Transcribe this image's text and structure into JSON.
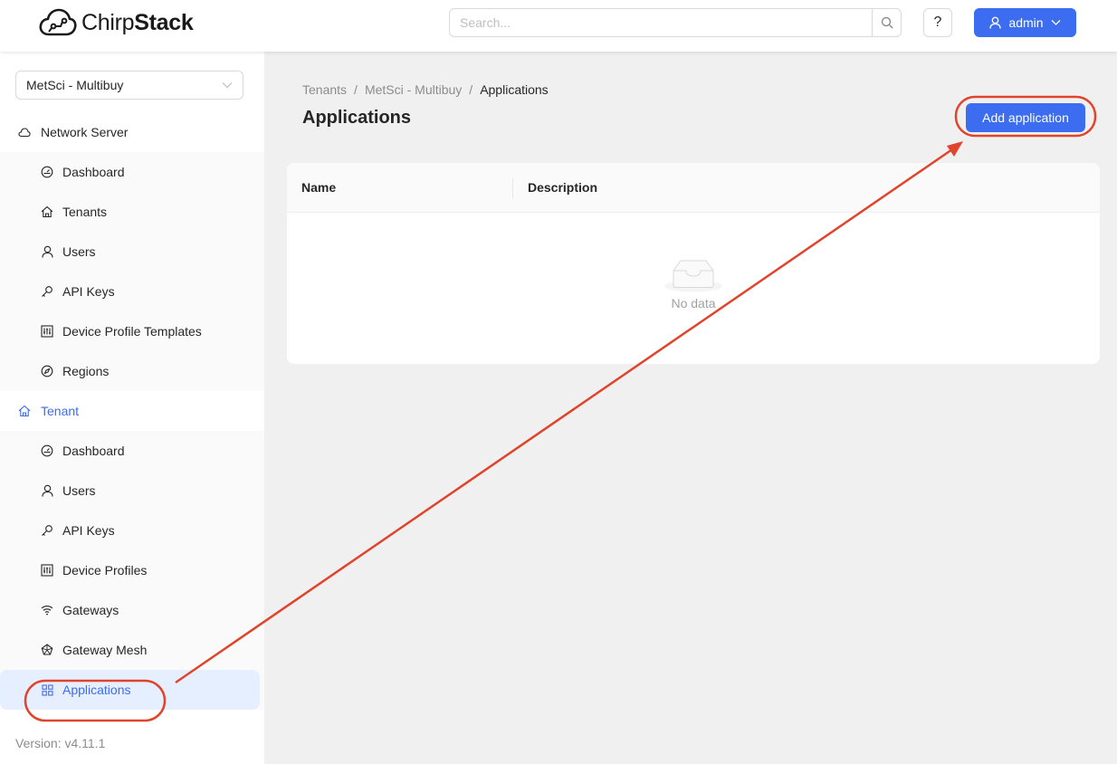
{
  "header": {
    "logo_light": "Chirp",
    "logo_bold": "Stack",
    "search_placeholder": "Search...",
    "help_label": "?",
    "user_label": "admin"
  },
  "sidebar": {
    "tenant_selected": "MetSci - Multibuy",
    "network_server": {
      "label": "Network Server",
      "items": [
        {
          "label": "Dashboard",
          "icon": "dashboard-icon"
        },
        {
          "label": "Tenants",
          "icon": "home-icon"
        },
        {
          "label": "Users",
          "icon": "user-icon"
        },
        {
          "label": "API Keys",
          "icon": "key-icon"
        },
        {
          "label": "Device Profile Templates",
          "icon": "sliders-icon"
        },
        {
          "label": "Regions",
          "icon": "compass-icon"
        }
      ]
    },
    "tenant": {
      "label": "Tenant",
      "items": [
        {
          "label": "Dashboard",
          "icon": "dashboard-icon"
        },
        {
          "label": "Users",
          "icon": "user-icon"
        },
        {
          "label": "API Keys",
          "icon": "key-icon"
        },
        {
          "label": "Device Profiles",
          "icon": "sliders-icon"
        },
        {
          "label": "Gateways",
          "icon": "wifi-icon"
        },
        {
          "label": "Gateway Mesh",
          "icon": "mesh-icon"
        },
        {
          "label": "Applications",
          "icon": "appstore-icon"
        }
      ]
    },
    "version": "Version: v4.11.1"
  },
  "main": {
    "breadcrumb": [
      "Tenants",
      "MetSci - Multibuy",
      "Applications"
    ],
    "breadcrumb_sep": "/",
    "title": "Applications",
    "add_button": "Add application",
    "table": {
      "columns": [
        "Name",
        "Description"
      ],
      "empty_text": "No data"
    }
  },
  "colors": {
    "primary": "#3c6df0",
    "annotation": "#e0442a"
  }
}
